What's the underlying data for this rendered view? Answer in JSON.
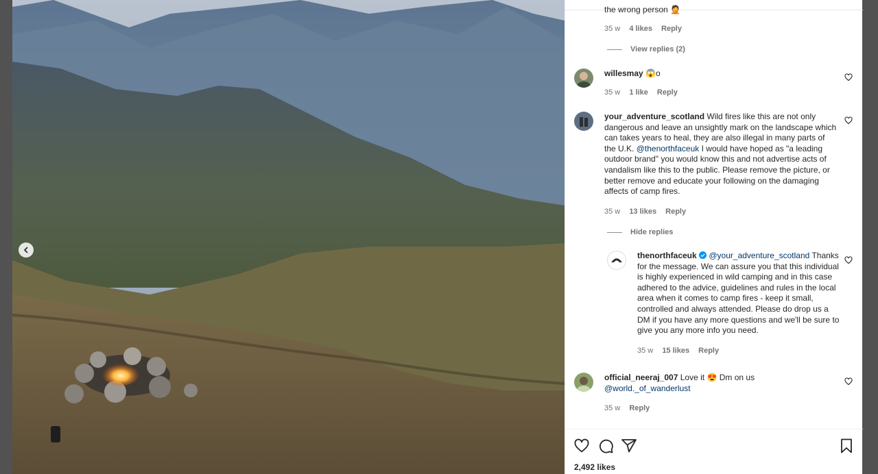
{
  "photo": {
    "alt": ""
  },
  "comments": [
    {
      "partial_text": "the wrong person",
      "emoji": "🤦",
      "time": "35 w",
      "likes": "4 likes",
      "reply": "Reply",
      "toggle": "View replies (2)"
    },
    {
      "user": "willesmay",
      "text": "😱o",
      "time": "35 w",
      "likes": "1 like",
      "reply": "Reply"
    },
    {
      "user": "your_adventure_scotland",
      "text_a": "Wild fires like this are not only dangerous and leave an unsightly mark on the landscape which can takes years to heal, they are also illegal in many parts of the U.K.",
      "mention": "@thenorthfaceuk",
      "text_b": "I would have hoped as \"a leading outdoor brand\" you would know this and not advertise acts of vandalism like this to the public. Please remove the picture, or better remove and educate your following on the damaging affects of camp fires.",
      "time": "35 w",
      "likes": "13 likes",
      "reply": "Reply",
      "toggle": "Hide replies"
    },
    {
      "user": "thenorthfaceuk",
      "verified": true,
      "mention": "@your_adventure_scotland",
      "text": "Thanks for the message. We can assure you that this individual is highly experienced in wild camping and in this case adhered to the advice, guidelines and rules in the local area when it comes to camp fires - keep it small, controlled and always attended. Please do drop us a DM if you have any more questions and we'll be sure to give you any more info you need.",
      "time": "35 w",
      "likes": "15 likes",
      "reply": "Reply"
    },
    {
      "user": "official_neeraj_007",
      "text_a": "Love it",
      "emoji": "😍",
      "text_b": "Dm on us",
      "mention": "@world._of_wanderlust",
      "time": "35 w",
      "reply": "Reply"
    }
  ],
  "actions": {
    "like_icon": "heart-icon",
    "comment_icon": "comment-icon",
    "share_icon": "share-icon",
    "save_icon": "bookmark-icon",
    "likes_count": "2,492 likes"
  },
  "colors": {
    "text": "#262626",
    "muted": "#737373",
    "link": "#00376b",
    "verified": "#0095f6"
  }
}
